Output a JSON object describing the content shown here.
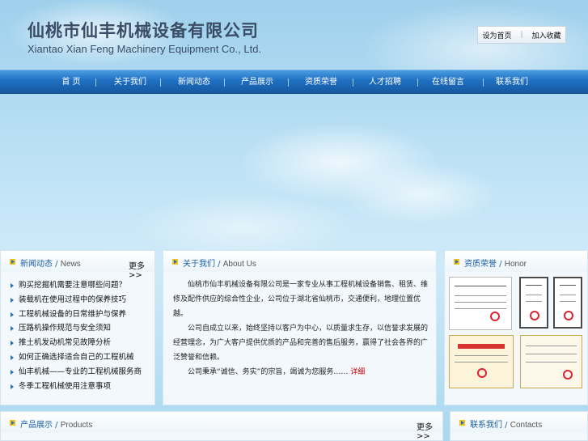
{
  "header": {
    "company_cn": "仙桃市仙丰机械设备有限公司",
    "company_en": "Xiantao Xian Feng Machinery Equipment Co., Ltd.",
    "toplinks": [
      "设为首页",
      "加入收藏"
    ]
  },
  "nav": {
    "items": [
      "首 页",
      "关于我们",
      "新闻动态",
      "产品展示",
      "资质荣誉",
      "人才招聘",
      "在线留言",
      "联系我们"
    ]
  },
  "news": {
    "title_cn": "新闻动态",
    "title_en": "News",
    "more": "更多>>",
    "items": [
      "购买挖掘机需要注意哪些问题？",
      "装载机在使用过程中的保养技巧",
      "工程机械设备的日常维护与保养",
      "压路机操作规范与安全须知",
      "推土机发动机常见故障分析",
      "如何正确选择适合自己的工程机械",
      "仙丰机械——专业的工程机械服务商",
      "冬季工程机械使用注意事项"
    ]
  },
  "about": {
    "title_cn": "关于我们",
    "title_en": "About Us",
    "paragraphs": [
      "仙桃市仙丰机械设备有限公司是一家专业从事工程机械设备销售、租赁、维修及配件供应的综合性企业，公司位于湖北省仙桃市，交通便利，地理位置优越。",
      "公司自成立以来，始终坚持以客户为中心，以质量求生存，以信誉求发展的经营理念，为广大客户提供优质的产品和完善的售后服务，赢得了社会各界的广泛赞誉和信赖。"
    ],
    "tail": "公司秉承“诚信、务实”的宗旨，竭诚为您服务……",
    "readmore": "详细"
  },
  "honor": {
    "title_cn": "资质荣誉",
    "title_en": "Honor"
  },
  "products": {
    "title_cn": "产品展示",
    "title_en": "Products",
    "more": "更多>>"
  },
  "contacts": {
    "title_cn": "联系我们",
    "title_en": "Contacts"
  },
  "colors": {
    "nav_blue": "#1f6fc2",
    "title_blue": "#1b5fa3",
    "readmore_red": "#cc0000",
    "icon_yellow": "#f2c21b"
  }
}
